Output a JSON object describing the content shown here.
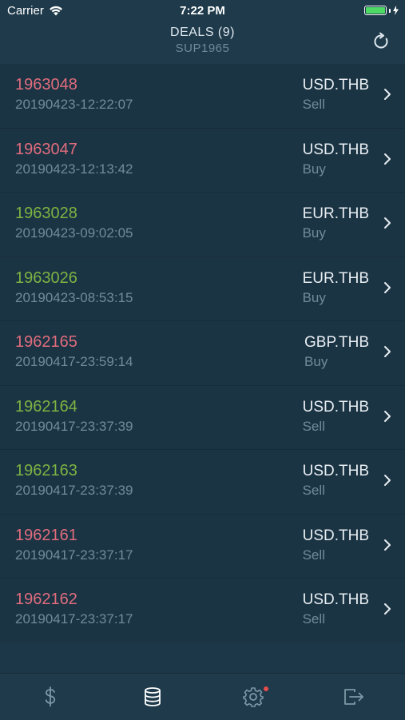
{
  "status": {
    "carrier": "Carrier",
    "time": "7:22 PM",
    "battery_level": 1.0
  },
  "nav": {
    "title": "DEALS (9)",
    "subtitle": "SUP1965"
  },
  "colors": {
    "loss": "#e06c7c",
    "gain": "#7cb342",
    "muted": "#6f8b99"
  },
  "deals": [
    {
      "id": "1963048",
      "timestamp": "20190423-12:22:07",
      "pair": "USD.THB",
      "side": "Sell",
      "status": "loss"
    },
    {
      "id": "1963047",
      "timestamp": "20190423-12:13:42",
      "pair": "USD.THB",
      "side": "Buy",
      "status": "loss"
    },
    {
      "id": "1963028",
      "timestamp": "20190423-09:02:05",
      "pair": "EUR.THB",
      "side": "Buy",
      "status": "gain"
    },
    {
      "id": "1963026",
      "timestamp": "20190423-08:53:15",
      "pair": "EUR.THB",
      "side": "Buy",
      "status": "gain"
    },
    {
      "id": "1962165",
      "timestamp": "20190417-23:59:14",
      "pair": "GBP.THB",
      "side": "Buy",
      "status": "loss"
    },
    {
      "id": "1962164",
      "timestamp": "20190417-23:37:39",
      "pair": "USD.THB",
      "side": "Sell",
      "status": "gain"
    },
    {
      "id": "1962163",
      "timestamp": "20190417-23:37:39",
      "pair": "USD.THB",
      "side": "Sell",
      "status": "gain"
    },
    {
      "id": "1962161",
      "timestamp": "20190417-23:37:17",
      "pair": "USD.THB",
      "side": "Sell",
      "status": "loss"
    },
    {
      "id": "1962162",
      "timestamp": "20190417-23:37:17",
      "pair": "USD.THB",
      "side": "Sell",
      "status": "loss"
    }
  ],
  "tabs": [
    {
      "name": "dollar-icon",
      "active": false
    },
    {
      "name": "database-icon",
      "active": true
    },
    {
      "name": "gear-icon",
      "active": false,
      "badge": true
    },
    {
      "name": "logout-icon",
      "active": false
    }
  ]
}
